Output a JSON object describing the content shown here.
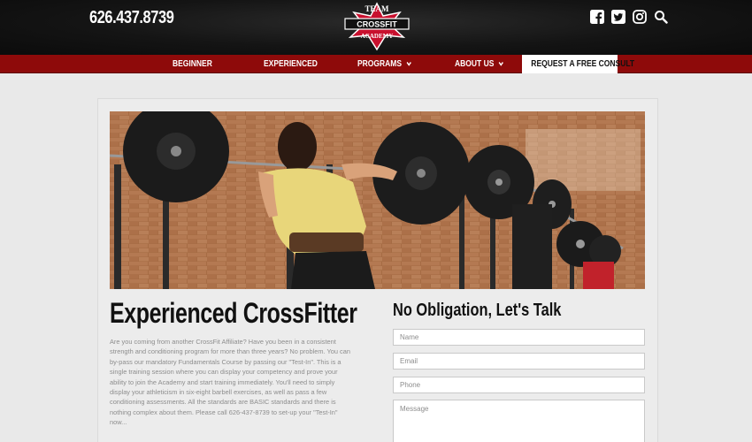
{
  "header": {
    "phone": "626.437.8739",
    "logo": {
      "top": "TEAM",
      "middle": "CROSSFIT",
      "bottom": "ACADEMY"
    },
    "social_icons": [
      "facebook-icon",
      "twitter-icon",
      "instagram-icon",
      "search-icon"
    ]
  },
  "nav": {
    "items": [
      {
        "label": "BEGINNER",
        "has_dropdown": false
      },
      {
        "label": "EXPERIENCED",
        "has_dropdown": false
      },
      {
        "label": "PROGRAMS",
        "has_dropdown": true
      },
      {
        "label": "ABOUT US",
        "has_dropdown": true
      }
    ],
    "cta": "REQUEST A FREE CONSULT",
    "caret": "❯"
  },
  "main": {
    "title": "Experienced CrossFitter",
    "body": "Are you coming from another CrossFit Affiliate?  Have you been in a consistent strength and conditioning program for more than three years?  No problem.  You can by-pass our mandatory Fundamentals Course by passing our \"Test-In\".  This is a single training session where you can display your competency and prove your ability to join the Academy and start training immediately.  You'll need to simply display your athleticism in six-eight barbell exercises, as well as pass a few conditioning assessments.  All the standards are BASIC standards and there is nothing complex about them.  Please call 626-437-8739 to set-up your \"Test-In\" now..."
  },
  "form": {
    "title": "No Obligation, Let's Talk",
    "name_placeholder": "Name",
    "email_placeholder": "Email",
    "phone_placeholder": "Phone",
    "message_placeholder": "Message"
  },
  "colors": {
    "nav_red": "#8e0a0a",
    "logo_red": "#c8102e",
    "header_black": "#141414"
  }
}
